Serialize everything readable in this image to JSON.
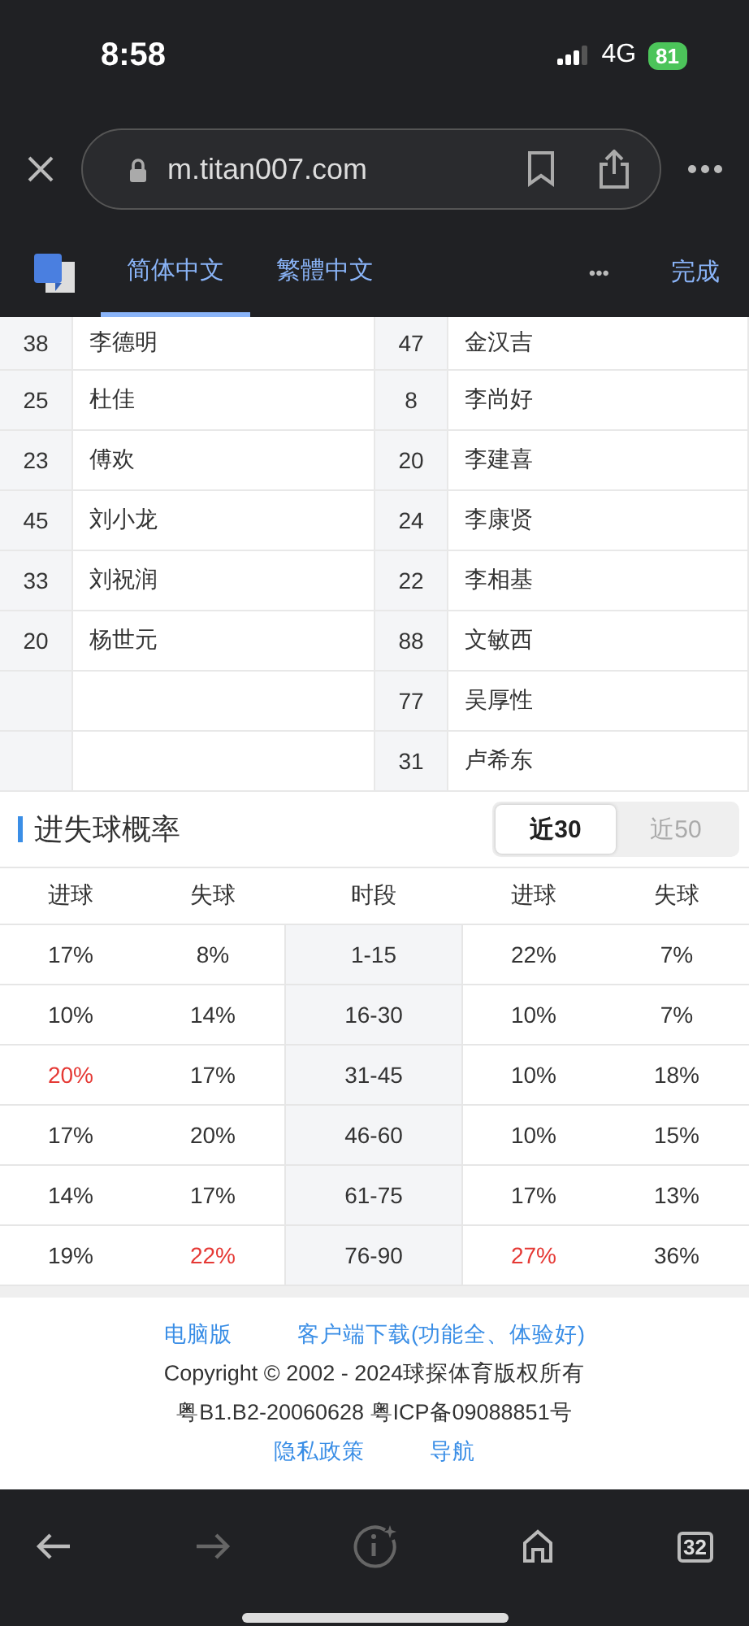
{
  "status_bar": {
    "time": "8:58",
    "network": "4G",
    "battery": "81"
  },
  "browser": {
    "url": "m.titan007.com"
  },
  "translate_bar": {
    "tabs": [
      {
        "label": "简体中文",
        "selected": true
      },
      {
        "label": "繁體中文",
        "selected": false
      }
    ],
    "more": "•••",
    "done": "完成"
  },
  "roster": {
    "rows": [
      [
        "38",
        "李德明",
        "47",
        "金汉吉"
      ],
      [
        "25",
        "杜佳",
        "8",
        "李尚好"
      ],
      [
        "23",
        "傅欢",
        "20",
        "李建喜"
      ],
      [
        "45",
        "刘小龙",
        "24",
        "李康贤"
      ],
      [
        "33",
        "刘祝润",
        "22",
        "李相基"
      ],
      [
        "20",
        "杨世元",
        "88",
        "文敏西"
      ],
      [
        "",
        "",
        "77",
        "吴厚性"
      ],
      [
        "",
        "",
        "31",
        "卢希东"
      ]
    ]
  },
  "goal_prob": {
    "title": "进失球概率",
    "segments": [
      {
        "label": "近30",
        "selected": true
      },
      {
        "label": "近50",
        "selected": false
      }
    ],
    "columns": [
      "进球",
      "失球",
      "时段",
      "进球",
      "失球"
    ],
    "rows": [
      [
        {
          "text": "17%",
          "highlight": false
        },
        {
          "text": "8%",
          "highlight": false
        },
        {
          "text": "1-15",
          "highlight": false
        },
        {
          "text": "22%",
          "highlight": false
        },
        {
          "text": "7%",
          "highlight": false
        }
      ],
      [
        {
          "text": "10%",
          "highlight": false
        },
        {
          "text": "14%",
          "highlight": false
        },
        {
          "text": "16-30",
          "highlight": false
        },
        {
          "text": "10%",
          "highlight": false
        },
        {
          "text": "7%",
          "highlight": false
        }
      ],
      [
        {
          "text": "20%",
          "highlight": true
        },
        {
          "text": "17%",
          "highlight": false
        },
        {
          "text": "31-45",
          "highlight": false
        },
        {
          "text": "10%",
          "highlight": false
        },
        {
          "text": "18%",
          "highlight": false
        }
      ],
      [
        {
          "text": "17%",
          "highlight": false
        },
        {
          "text": "20%",
          "highlight": false
        },
        {
          "text": "46-60",
          "highlight": false
        },
        {
          "text": "10%",
          "highlight": false
        },
        {
          "text": "15%",
          "highlight": false
        }
      ],
      [
        {
          "text": "14%",
          "highlight": false
        },
        {
          "text": "17%",
          "highlight": false
        },
        {
          "text": "61-75",
          "highlight": false
        },
        {
          "text": "17%",
          "highlight": false
        },
        {
          "text": "13%",
          "highlight": false
        }
      ],
      [
        {
          "text": "19%",
          "highlight": false
        },
        {
          "text": "22%",
          "highlight": true
        },
        {
          "text": "76-90",
          "highlight": false
        },
        {
          "text": "27%",
          "highlight": true
        },
        {
          "text": "36%",
          "highlight": false
        }
      ]
    ]
  },
  "footer": {
    "links_top": [
      "电脑版",
      "客户端下载(功能全、体验好)"
    ],
    "copyright": "Copyright © 2002 - 2024球探体育版权所有",
    "license": "粤B1.B2-20060628 粤ICP备09088851号",
    "links_bottom": [
      "隐私政策",
      "导航"
    ]
  },
  "bottom_bar": {
    "tab_count": "32"
  }
}
